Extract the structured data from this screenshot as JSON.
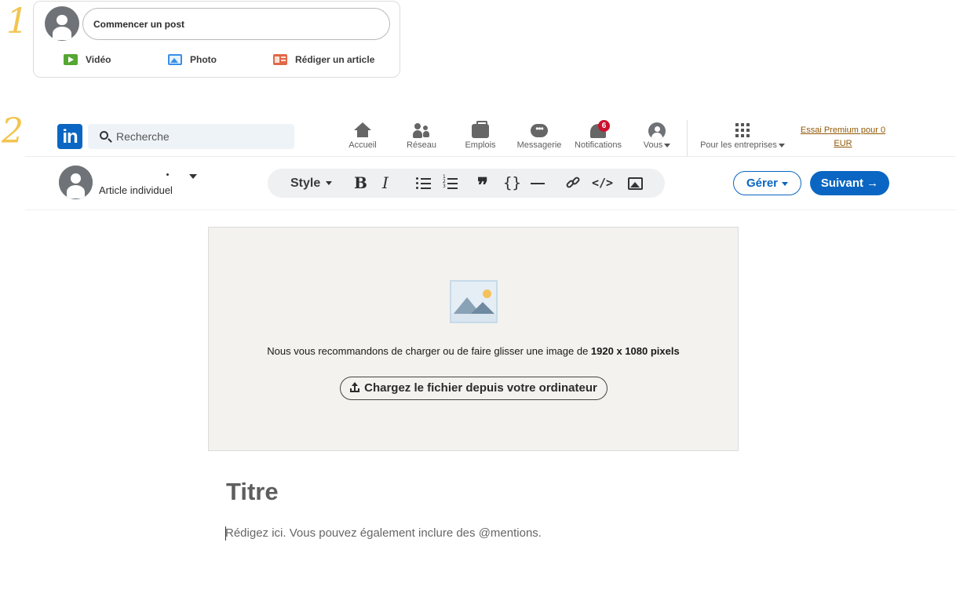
{
  "steps": [
    "1",
    "2"
  ],
  "composer": {
    "start_post": "Commencer un post",
    "actions": [
      {
        "label": "Vidéo",
        "icon": "video-icon",
        "color": "#55a632"
      },
      {
        "label": "Photo",
        "icon": "photo-icon",
        "color": "#378fe9"
      },
      {
        "label": "Rédiger un article",
        "icon": "article-icon",
        "color": "#e06847"
      }
    ]
  },
  "nav": {
    "logo": "in",
    "search_placeholder": "Recherche",
    "items": [
      {
        "label": "Accueil",
        "icon": "home-icon"
      },
      {
        "label": "Réseau",
        "icon": "network-icon"
      },
      {
        "label": "Emplois",
        "icon": "jobs-icon"
      },
      {
        "label": "Messagerie",
        "icon": "messaging-icon"
      },
      {
        "label": "Notifications",
        "icon": "bell-icon",
        "badge": "6"
      },
      {
        "label": "Vous",
        "icon": "me-icon"
      },
      {
        "label": "Pour les entreprises",
        "icon": "grid-icon"
      }
    ],
    "premium": "Essai Premium pour 0 EUR",
    "accent": "#0a66c2",
    "badge_color": "#cb112d"
  },
  "editor": {
    "author_type": "Article individuel",
    "toolbar": {
      "style": "Style",
      "bold": "B",
      "italic": "I",
      "quote": "❞",
      "code": "{}",
      "embed": "</>"
    },
    "manage": "Gérer",
    "next": "Suivant →"
  },
  "cover": {
    "hint_prefix": "Nous vous recommandons de charger ou de faire glisser une image de ",
    "hint_size": "1920 x 1080 pixels",
    "upload": "Chargez le fichier depuis votre ordinateur"
  },
  "article": {
    "title_placeholder": "Titre",
    "body_placeholder": "Rédigez ici. Vous pouvez également inclure des @mentions."
  }
}
